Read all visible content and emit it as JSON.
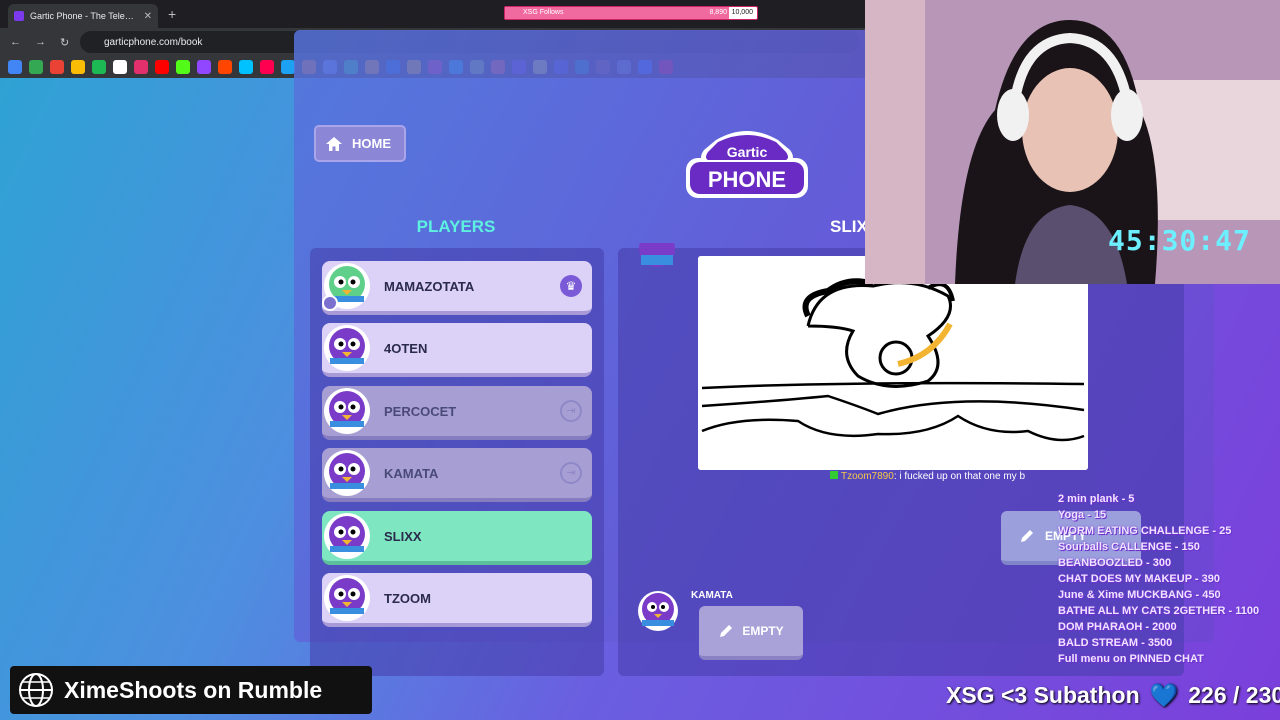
{
  "browser": {
    "tab_title": "Gartic Phone - The Telephone G",
    "tab_close": "✕",
    "new_tab": "+",
    "url": "garticphone.com/book",
    "bookmark_colors": [
      "#4285f4",
      "#34a853",
      "#ea4335",
      "#fbbc05",
      "#1db954",
      "#ffffff",
      "#e1306c",
      "#ff0000",
      "#53fc18",
      "#9146ff",
      "#ff4500",
      "#00c2ff",
      "#ff0050",
      "#1da1f2",
      "#ff6d00",
      "#7289da",
      "#25d366",
      "#ff9900",
      "#0a66c2",
      "#f4b400",
      "#e91e63",
      "#00bcd4",
      "#8bc34a",
      "#ff5722",
      "#673ab7",
      "#cddc39",
      "#3f51b5",
      "#009688",
      "#795548",
      "#607d8b",
      "#1877f2",
      "#e60023"
    ]
  },
  "follows_bar": {
    "label": "XSG Follows",
    "count": "8,890",
    "goal": "10,000",
    "progress": 0.889
  },
  "game": {
    "home_label": "HOME",
    "logo_top": "Gartic",
    "logo_bottom": "PHONE",
    "players_title": "PLAYERS",
    "album_title": "SLIX",
    "players": [
      {
        "name": "MAMAZOTATA",
        "state": "host",
        "badge": "♛",
        "avatar_color": "#5fd08a"
      },
      {
        "name": "4OTEN",
        "state": "normal",
        "badge": "",
        "avatar_color": "#7a3cc8"
      },
      {
        "name": "PERCOCET",
        "state": "left",
        "badge": "⇥",
        "avatar_color": "#7a3cc8"
      },
      {
        "name": "KAMATA",
        "state": "left",
        "badge": "⇥",
        "avatar_color": "#7a3cc8"
      },
      {
        "name": "SLIXX",
        "state": "active",
        "badge": "",
        "avatar_color": "#7a3cc8"
      },
      {
        "name": "TZOOM",
        "state": "normal",
        "badge": "",
        "avatar_color": "#7a3cc8"
      }
    ],
    "chat": {
      "user": "Tzoom7890",
      "message": ": i fucked up on that one my b"
    },
    "kamata_label": "KAMATA",
    "empty_label": "EMPTY",
    "empty_label_2": "EMPTY"
  },
  "cam": {
    "timer": "45:30:47"
  },
  "menu": [
    "2 min plank - 5",
    "Yoga - 15",
    "WORM EATING CHALLENGE - 25",
    "Sourballs CALLENGE - 150",
    "BEANBOOZLED - 300",
    "CHAT DOES MY MAKEUP - 390",
    "June & Xime MUCKBANG - 450",
    "BATHE ALL MY CATS 2GETHER - 1100",
    "DOM PHARAOH - 2000",
    "BALD STREAM - 3500",
    "Full menu on PINNED CHAT"
  ],
  "rumble_text": "XimeShoots on Rumble",
  "subathon": {
    "label": "XSG <3 Subathon",
    "heart": "💙",
    "count": "226 / 230"
  }
}
